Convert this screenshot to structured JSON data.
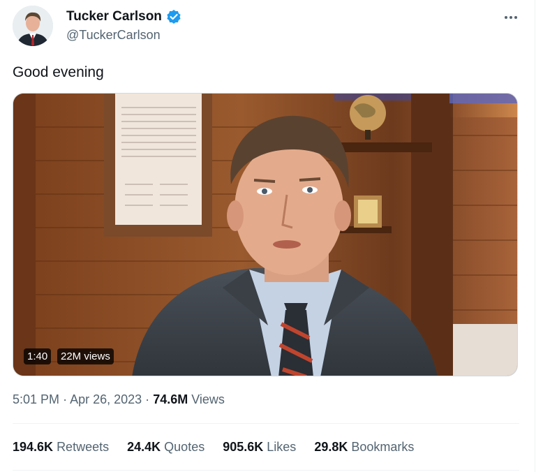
{
  "author": {
    "name": "Tucker Carlson",
    "handle": "@TuckerCarlson",
    "verified_icon": "verified-badge-icon",
    "accent": "#1d9bf0"
  },
  "tweet": {
    "text": "Good evening",
    "time": "5:01 PM",
    "separator": "·",
    "date": "Apr 26, 2023",
    "views_count": "74.6M",
    "views_label": "Views"
  },
  "video": {
    "duration": "1:40",
    "views": "22M views"
  },
  "stats": [
    {
      "count": "194.6K",
      "label": "Retweets"
    },
    {
      "count": "24.4K",
      "label": "Quotes"
    },
    {
      "count": "905.6K",
      "label": "Likes"
    },
    {
      "count": "29.8K",
      "label": "Bookmarks"
    }
  ],
  "more_icon": "more-options-icon"
}
